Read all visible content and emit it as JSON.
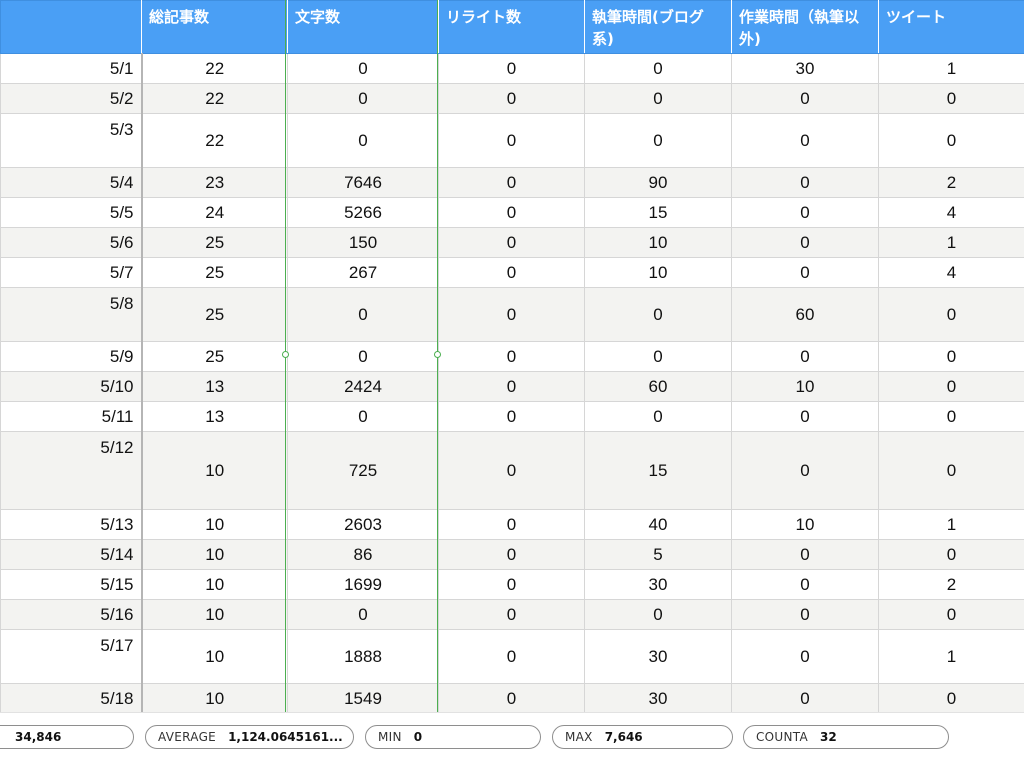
{
  "headers": [
    "",
    "総記事数",
    "文字数",
    "リライト数",
    "執筆時間(ブログ系)",
    "作業時間（執筆以外)",
    "ツイート"
  ],
  "rows": [
    {
      "date": "5/1",
      "cells": [
        "22",
        "0",
        "0",
        "0",
        "30",
        "1"
      ]
    },
    {
      "date": "5/2",
      "cells": [
        "22",
        "0",
        "0",
        "0",
        "0",
        "0"
      ]
    },
    {
      "date": "5/3",
      "cells": [
        "22",
        "0",
        "0",
        "0",
        "0",
        "0"
      ]
    },
    {
      "date": "5/4",
      "cells": [
        "23",
        "7646",
        "0",
        "90",
        "0",
        "2"
      ]
    },
    {
      "date": "5/5",
      "cells": [
        "24",
        "5266",
        "0",
        "15",
        "0",
        "4"
      ]
    },
    {
      "date": "5/6",
      "cells": [
        "25",
        "150",
        "0",
        "10",
        "0",
        "1"
      ]
    },
    {
      "date": "5/7",
      "cells": [
        "25",
        "267",
        "0",
        "10",
        "0",
        "4"
      ]
    },
    {
      "date": "5/8",
      "cells": [
        "25",
        "0",
        "0",
        "0",
        "60",
        "0"
      ]
    },
    {
      "date": "5/9",
      "cells": [
        "25",
        "0",
        "0",
        "0",
        "0",
        "0"
      ]
    },
    {
      "date": "5/10",
      "cells": [
        "13",
        "2424",
        "0",
        "60",
        "10",
        "0"
      ]
    },
    {
      "date": "5/11",
      "cells": [
        "13",
        "0",
        "0",
        "0",
        "0",
        "0"
      ]
    },
    {
      "date": "5/12",
      "cells": [
        "10",
        "725",
        "0",
        "15",
        "0",
        "0"
      ]
    },
    {
      "date": "5/13",
      "cells": [
        "10",
        "2603",
        "0",
        "40",
        "10",
        "1"
      ]
    },
    {
      "date": "5/14",
      "cells": [
        "10",
        "86",
        "0",
        "5",
        "0",
        "0"
      ]
    },
    {
      "date": "5/15",
      "cells": [
        "10",
        "1699",
        "0",
        "30",
        "0",
        "2"
      ]
    },
    {
      "date": "5/16",
      "cells": [
        "10",
        "0",
        "0",
        "0",
        "0",
        "0"
      ]
    },
    {
      "date": "5/17",
      "cells": [
        "10",
        "1888",
        "0",
        "30",
        "0",
        "1"
      ]
    },
    {
      "date": "5/18",
      "cells": [
        "10",
        "1549",
        "0",
        "30",
        "0",
        "0"
      ]
    }
  ],
  "status": {
    "sum_value": "34,846",
    "average_label": "AVERAGE",
    "average_value": "1,124.0645161...",
    "min_label": "MIN",
    "min_value": "0",
    "max_label": "MAX",
    "max_value": "7,646",
    "counta_label": "COUNTA",
    "counta_value": "32"
  }
}
